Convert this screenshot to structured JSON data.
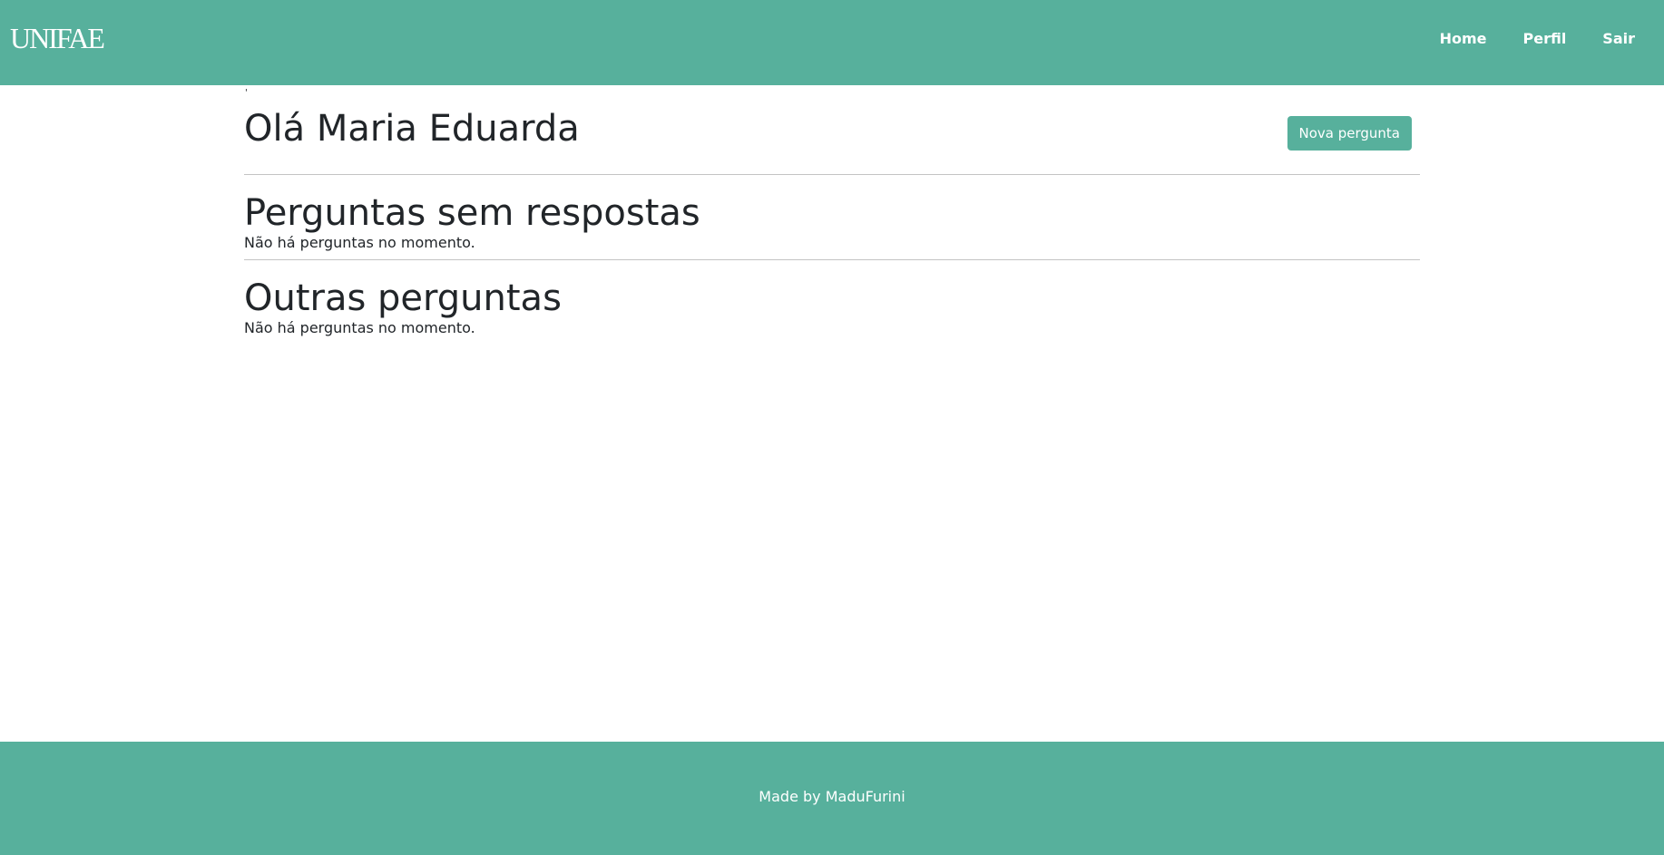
{
  "brand": {
    "logo_text": "UNIFAE",
    "accent_color": "#57b09c"
  },
  "nav": {
    "items": [
      {
        "label": "Home"
      },
      {
        "label": "Perfil"
      },
      {
        "label": "Sair"
      }
    ]
  },
  "main": {
    "tick_mark": "'",
    "greeting": "Olá Maria Eduarda",
    "new_question_button": "Nova pergunta",
    "sections": [
      {
        "title": "Perguntas sem respostas",
        "empty_message": "Não há perguntas no momento."
      },
      {
        "title": "Outras perguntas",
        "empty_message": "Não há perguntas no momento."
      }
    ]
  },
  "footer": {
    "text": "Made by MaduFurini"
  }
}
